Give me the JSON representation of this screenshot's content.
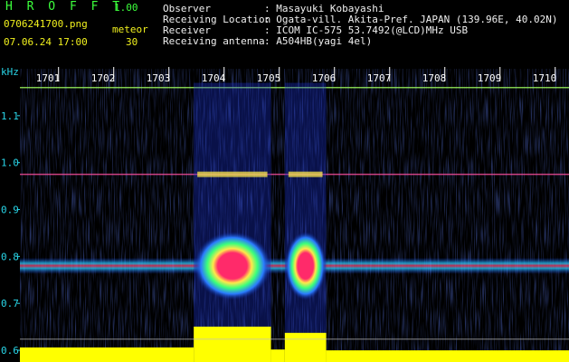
{
  "app": {
    "name": "H R O F F T",
    "version": "1.00",
    "filename": "0706241700.png",
    "datetime": "07.06.24 17:00",
    "meteor_label": "meteor",
    "meteor_count": "30"
  },
  "info": {
    "observer_label": "Observer",
    "observer_value": ": Masayuki Kobayashi",
    "location_label": "Receiving Location",
    "location_value": ": Ogata-vill. Akita-Pref. JAPAN (139.96E, 40.02N)",
    "receiver_label": "Receiver",
    "receiver_value": ": ICOM IC-575 53.7492(@LCD)MHz USB",
    "antenna_label": "Receiving antenna",
    "antenna_value": ": A504HB(yagi 4el)"
  },
  "colors": {
    "background": "#000000",
    "axis_text": "#29d6e8",
    "title_green": "#3cff3c",
    "info_yellow": "#f2f21e",
    "echo_core": "#ff2a6a",
    "echo_mid": "#ffe84a",
    "echo_outer": "#3cff7a",
    "noise": "#1a30d0",
    "power_bar": "#ffff00"
  },
  "chart_data": {
    "type": "heatmap",
    "ylabel": "kHz",
    "ylim": [
      0.575,
      1.2
    ],
    "y_ticks": [
      "1.1",
      "1.0",
      "0.9",
      "0.8",
      "0.7",
      "0.6"
    ],
    "y_tick_values": [
      1.1,
      1.0,
      0.9,
      0.8,
      0.7,
      0.6
    ],
    "x_ticks": [
      "1701",
      "1702",
      "1703",
      "1704",
      "1705",
      "1706",
      "1707",
      "1708",
      "1709",
      "1710"
    ],
    "xlim": [
      1700.3,
      1710.25
    ],
    "carrier_khz": 0.78,
    "interference_lines_khz": [
      1.16,
      0.975
    ],
    "echo_bursts": [
      {
        "start": 1703.45,
        "end": 1704.85,
        "center_khz": 0.78
      },
      {
        "start": 1705.1,
        "end": 1705.85,
        "center_khz": 0.78
      }
    ],
    "power_level": [
      {
        "start": 1700.3,
        "end": 1703.45,
        "level": 0.35
      },
      {
        "start": 1703.45,
        "end": 1704.85,
        "level": 0.85
      },
      {
        "start": 1704.85,
        "end": 1705.1,
        "level": 0.3
      },
      {
        "start": 1705.1,
        "end": 1705.85,
        "level": 0.7
      },
      {
        "start": 1705.85,
        "end": 1710.25,
        "level": 0.28
      }
    ]
  }
}
